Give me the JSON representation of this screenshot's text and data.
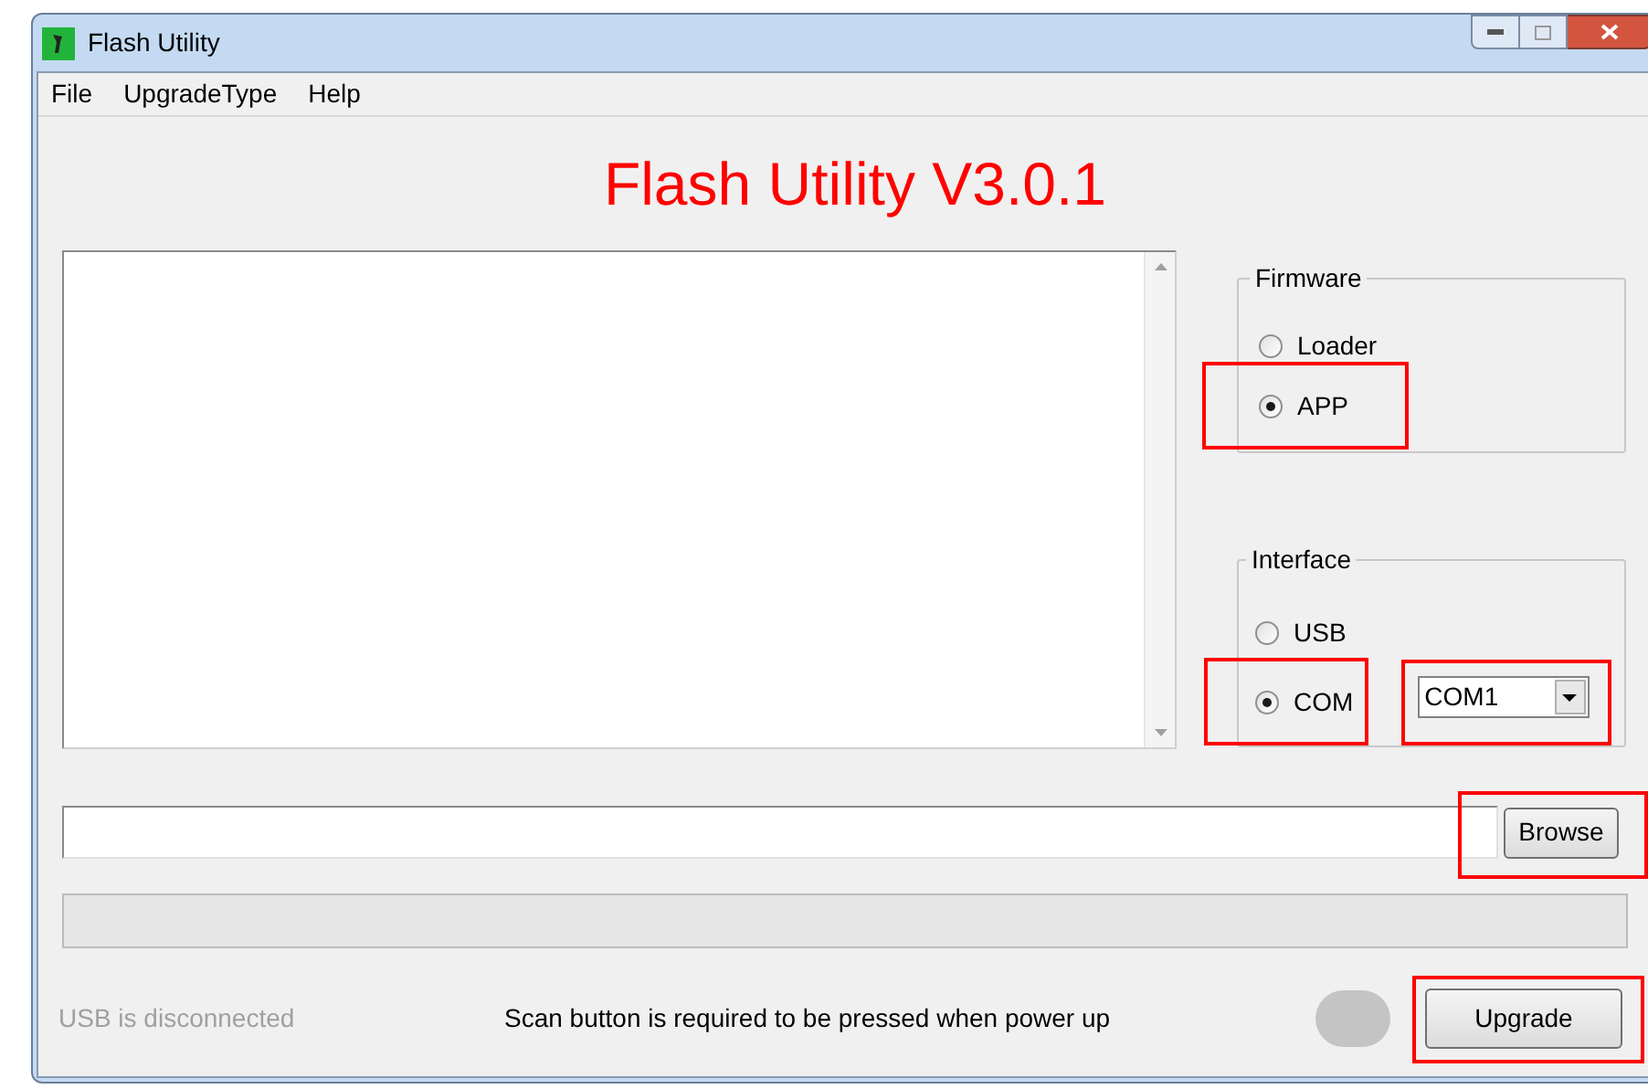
{
  "window": {
    "title": "Flash Utility"
  },
  "menu": [
    {
      "label": "File"
    },
    {
      "label": "UpgradeType"
    },
    {
      "label": "Help"
    }
  ],
  "heading": "Flash Utility V3.0.1",
  "firmware": {
    "label": "Firmware",
    "options": [
      {
        "label": "Loader",
        "selected": false,
        "highlighted": false
      },
      {
        "label": "APP",
        "selected": true,
        "highlighted": true
      }
    ]
  },
  "interface": {
    "label": "Interface",
    "options": [
      {
        "label": "USB",
        "selected": false,
        "highlighted": false
      },
      {
        "label": "COM",
        "selected": true,
        "highlighted": true
      }
    ],
    "port": {
      "value": "COM1",
      "highlighted": true
    }
  },
  "browse_button": {
    "label": "Browse",
    "highlighted": true
  },
  "progress": {
    "level": 0
  },
  "status": {
    "connection": "USB is disconnected",
    "hint": "Scan button is required to be pressed when power up",
    "indicator_on": false
  },
  "upgrade_button": {
    "label": "Upgrade",
    "highlighted": true
  }
}
